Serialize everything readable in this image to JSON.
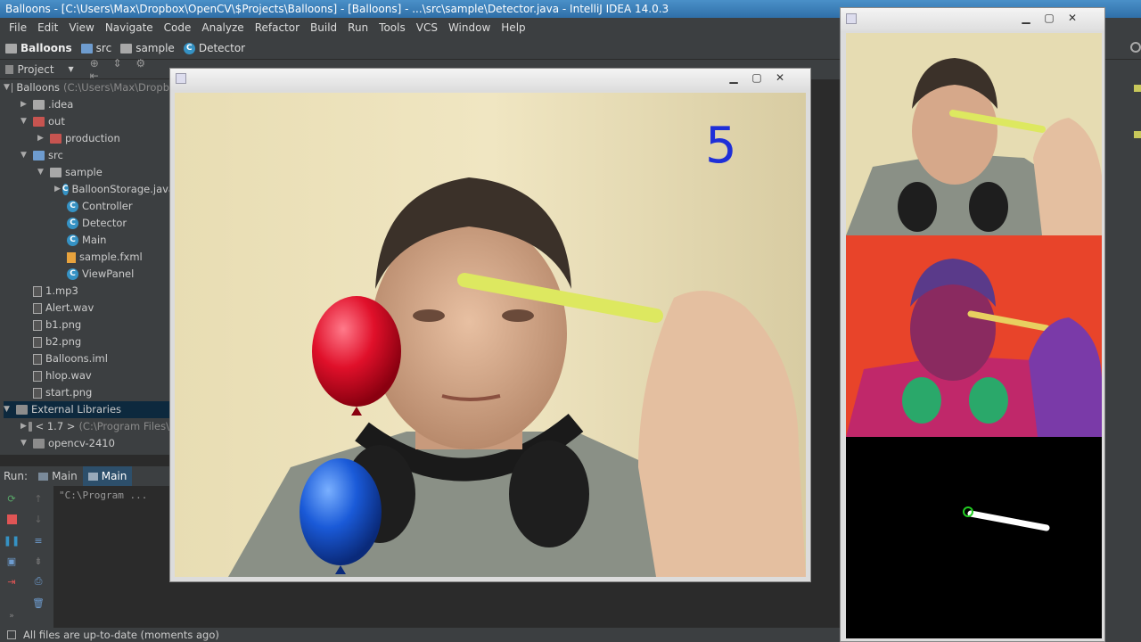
{
  "ide": {
    "window_title": "Balloons - [C:\\Users\\Max\\Dropbox\\OpenCV\\$Projects\\Balloons] - [Balloons] - ...\\src\\sample\\Detector.java - IntelliJ IDEA 14.0.3",
    "menu": [
      "File",
      "Edit",
      "View",
      "Navigate",
      "Code",
      "Analyze",
      "Refactor",
      "Build",
      "Run",
      "Tools",
      "VCS",
      "Window",
      "Help"
    ],
    "breadcrumbs": [
      "Balloons",
      "src",
      "sample",
      "Detector"
    ],
    "project_panel": {
      "title": "Project"
    },
    "tree": [
      {
        "label": "Balloons",
        "sub": "(C:\\Users\\Max\\Dropb",
        "icon": "folder-icon",
        "level": 0,
        "expanded": true
      },
      {
        "label": ".idea",
        "icon": "folder-icon",
        "level": 1,
        "expanded": false
      },
      {
        "label": "out",
        "icon": "folder-red-icon",
        "level": 1,
        "expanded": true
      },
      {
        "label": "production",
        "icon": "folder-red-icon",
        "level": 2,
        "expanded": false
      },
      {
        "label": "src",
        "icon": "folder-blue-icon",
        "level": 1,
        "expanded": true
      },
      {
        "label": "sample",
        "icon": "folder-icon",
        "level": 2,
        "expanded": true
      },
      {
        "label": "BalloonStorage.java",
        "icon": "class-icon",
        "level": 3,
        "expanded": false
      },
      {
        "label": "Controller",
        "icon": "class-icon",
        "level": 3
      },
      {
        "label": "Detector",
        "icon": "class-icon",
        "level": 3
      },
      {
        "label": "Main",
        "icon": "class-icon",
        "level": 3
      },
      {
        "label": "sample.fxml",
        "icon": "fxml-icon",
        "level": 3
      },
      {
        "label": "ViewPanel",
        "icon": "class-icon",
        "level": 3
      },
      {
        "label": "1.mp3",
        "icon": "file-icon",
        "level": 1
      },
      {
        "label": "Alert.wav",
        "icon": "file-icon",
        "level": 1
      },
      {
        "label": "b1.png",
        "icon": "file-icon",
        "level": 1
      },
      {
        "label": "b2.png",
        "icon": "file-icon",
        "level": 1
      },
      {
        "label": "Balloons.iml",
        "icon": "file-icon",
        "level": 1
      },
      {
        "label": "hlop.wav",
        "icon": "file-icon",
        "level": 1
      },
      {
        "label": "start.png",
        "icon": "file-icon",
        "level": 1
      },
      {
        "label": "External Libraries",
        "icon": "library-icon",
        "level": 0,
        "expanded": true
      },
      {
        "label": "< 1.7 >",
        "sub": "(C:\\Program Files\\",
        "icon": "library-icon",
        "level": 1,
        "expanded": false
      },
      {
        "label": "opencv-2410",
        "icon": "library-icon",
        "level": 1,
        "expanded": true
      }
    ],
    "run_panel": {
      "title": "Run:",
      "tabs": [
        "Main",
        "Main"
      ],
      "console_text": "\"C:\\Program ..."
    },
    "status": "All files are up-to-date (moments ago)"
  },
  "game": {
    "score": "5",
    "balloons": [
      "red balloon",
      "blue balloon"
    ]
  },
  "colors": {
    "ide_bg": "#2b2b2b",
    "panel_bg": "#3c3f41",
    "title_blue": "#2f6fa8",
    "score_blue": "#1e2fd8"
  }
}
